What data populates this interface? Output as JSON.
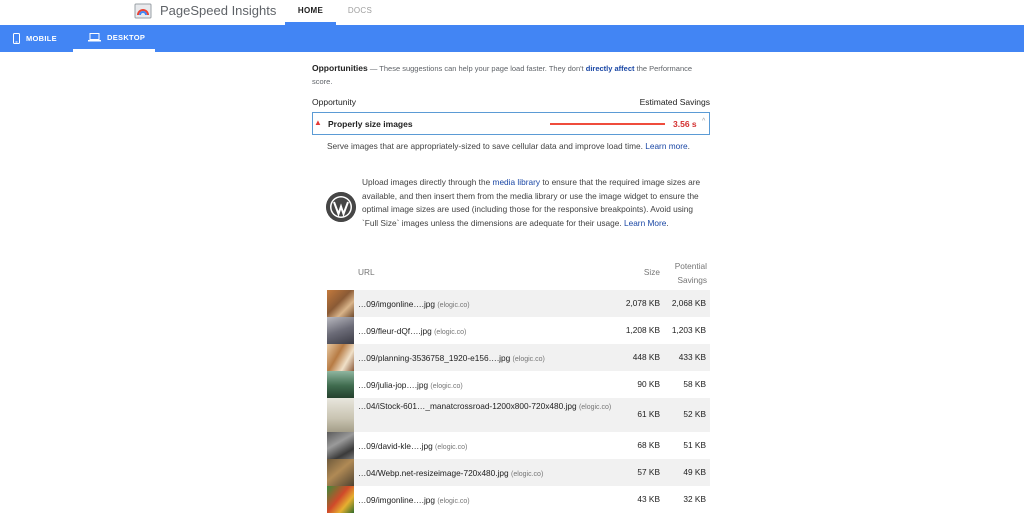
{
  "header": {
    "brand": "PageSpeed Insights",
    "nav": [
      {
        "label": "HOME"
      },
      {
        "label": "DOCS"
      }
    ]
  },
  "device_tabs": [
    {
      "label": "MOBILE",
      "icon": "smartphone-icon"
    },
    {
      "label": "DESKTOP",
      "icon": "laptop-icon",
      "selected": true
    }
  ],
  "opportunities": {
    "title": "Opportunities",
    "dash": "—",
    "subtitle_pre": "These suggestions can help your page load faster. They don't",
    "subtitle_link": "directly affect",
    "subtitle_post": "the Performance score.",
    "col_opportunity": "Opportunity",
    "col_savings": "Estimated Savings"
  },
  "audit": {
    "title": "Properly size images",
    "savings": "3.56 s",
    "savings_fraction": 1.0,
    "description_pre": "Serve images that are appropriately-sized to save cellular data and improve load time.",
    "description_link": "Learn more",
    "description_post": ".",
    "wp_text_1": "Upload images directly through the",
    "wp_link_1": "media library",
    "wp_text_2": "to ensure that the required image sizes are available, and then insert them from the media library or use the image widget to ensure the optimal image sizes are used (including those for the responsive breakpoints). Avoid using `Full Size` images unless the dimensions are adequate for their usage.",
    "wp_link_2": "Learn More",
    "wp_text_3": "."
  },
  "table": {
    "headers": {
      "url": "URL",
      "size": "Size",
      "potential": "Potential",
      "savings": "Savings"
    },
    "rows": [
      {
        "url": "…09/imgonline….jpg",
        "host": "(elogic.co)",
        "size": "2,078 KB",
        "savings": "2,068 KB"
      },
      {
        "url": "…09/fleur-dQf….jpg",
        "host": "(elogic.co)",
        "size": "1,208 KB",
        "savings": "1,203 KB"
      },
      {
        "url": "…09/planning-3536758_1920-e156….jpg",
        "host": "(elogic.co)",
        "size": "448 KB",
        "savings": "433 KB"
      },
      {
        "url": "…09/julia-jop….jpg",
        "host": "(elogic.co)",
        "size": "90 KB",
        "savings": "58 KB"
      },
      {
        "url": "…04/iStock-601…_manatcrossroad-1200x800-720x480.jpg",
        "host": "(elogic.co)",
        "size": "61 KB",
        "savings": "52 KB"
      },
      {
        "url": "…09/david-kle….jpg",
        "host": "(elogic.co)",
        "size": "68 KB",
        "savings": "51 KB"
      },
      {
        "url": "…04/Webp.net-resizeimage-720x480.jpg",
        "host": "(elogic.co)",
        "size": "57 KB",
        "savings": "49 KB"
      },
      {
        "url": "…09/imgonline….jpg",
        "host": "(elogic.co)",
        "size": "43 KB",
        "savings": "32 KB"
      }
    ]
  },
  "colors": {
    "accent": "#4285f4",
    "fail": "#e53935",
    "link": "#1a47a5"
  }
}
